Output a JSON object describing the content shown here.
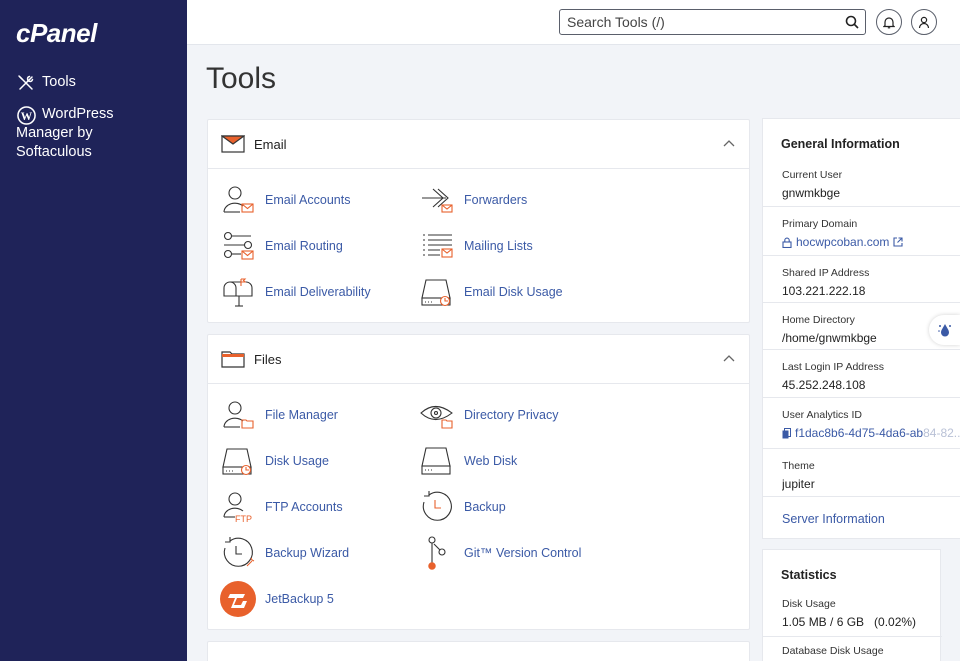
{
  "sidebar": {
    "logo": "cPanel",
    "items": [
      {
        "label": "Tools",
        "icon": "tools-icon"
      },
      {
        "label": "WordPress Manager by Softaculous",
        "icon": "wordpress-icon"
      }
    ]
  },
  "topbar": {
    "search_placeholder": "Search Tools (/)"
  },
  "page_title": "Tools",
  "email_section": {
    "title": "Email",
    "tools": [
      {
        "label": "Email Accounts",
        "icon": "email-accounts-icon"
      },
      {
        "label": "Forwarders",
        "icon": "forwarders-icon"
      },
      {
        "label": "Email Routing",
        "icon": "email-routing-icon"
      },
      {
        "label": "Mailing Lists",
        "icon": "mailing-lists-icon"
      },
      {
        "label": "Email Deliverability",
        "icon": "email-deliverability-icon"
      },
      {
        "label": "Email Disk Usage",
        "icon": "email-disk-usage-icon"
      }
    ]
  },
  "files_section": {
    "title": "Files",
    "tools": [
      {
        "label": "File Manager",
        "icon": "file-manager-icon"
      },
      {
        "label": "Directory Privacy",
        "icon": "directory-privacy-icon"
      },
      {
        "label": "Disk Usage",
        "icon": "disk-usage-icon"
      },
      {
        "label": "Web Disk",
        "icon": "web-disk-icon"
      },
      {
        "label": "FTP Accounts",
        "icon": "ftp-accounts-icon"
      },
      {
        "label": "Backup",
        "icon": "backup-icon"
      },
      {
        "label": "Backup Wizard",
        "icon": "backup-wizard-icon"
      },
      {
        "label": "Git™ Version Control",
        "icon": "git-icon"
      },
      {
        "label": "JetBackup 5",
        "icon": "jetbackup-icon"
      }
    ]
  },
  "general_info": {
    "title": "General Information",
    "current_user_label": "Current User",
    "current_user": "gnwmkbge",
    "primary_domain_label": "Primary Domain",
    "primary_domain": "hocwpcoban.com",
    "shared_ip_label": "Shared IP Address",
    "shared_ip": "103.221.222.18",
    "home_dir_label": "Home Directory",
    "home_dir": "/home/gnwmkbge",
    "last_login_label": "Last Login IP Address",
    "last_login": "45.252.248.108",
    "analytics_label": "User Analytics ID",
    "analytics_id_visible": "f1dac8b6-4d75-4da6-ab",
    "analytics_id_faded": "84-82...",
    "theme_label": "Theme",
    "theme": "jupiter",
    "server_info_link": "Server Information"
  },
  "statistics": {
    "title": "Statistics",
    "disk_usage_label": "Disk Usage",
    "disk_usage": "1.05 MB / 6 GB   (0.02%)",
    "db_disk_usage_label": "Database Disk Usage"
  },
  "colors": {
    "sidebar_bg": "#1f2359",
    "link": "#3b5aa6",
    "accent_orange": "#e8612c"
  }
}
